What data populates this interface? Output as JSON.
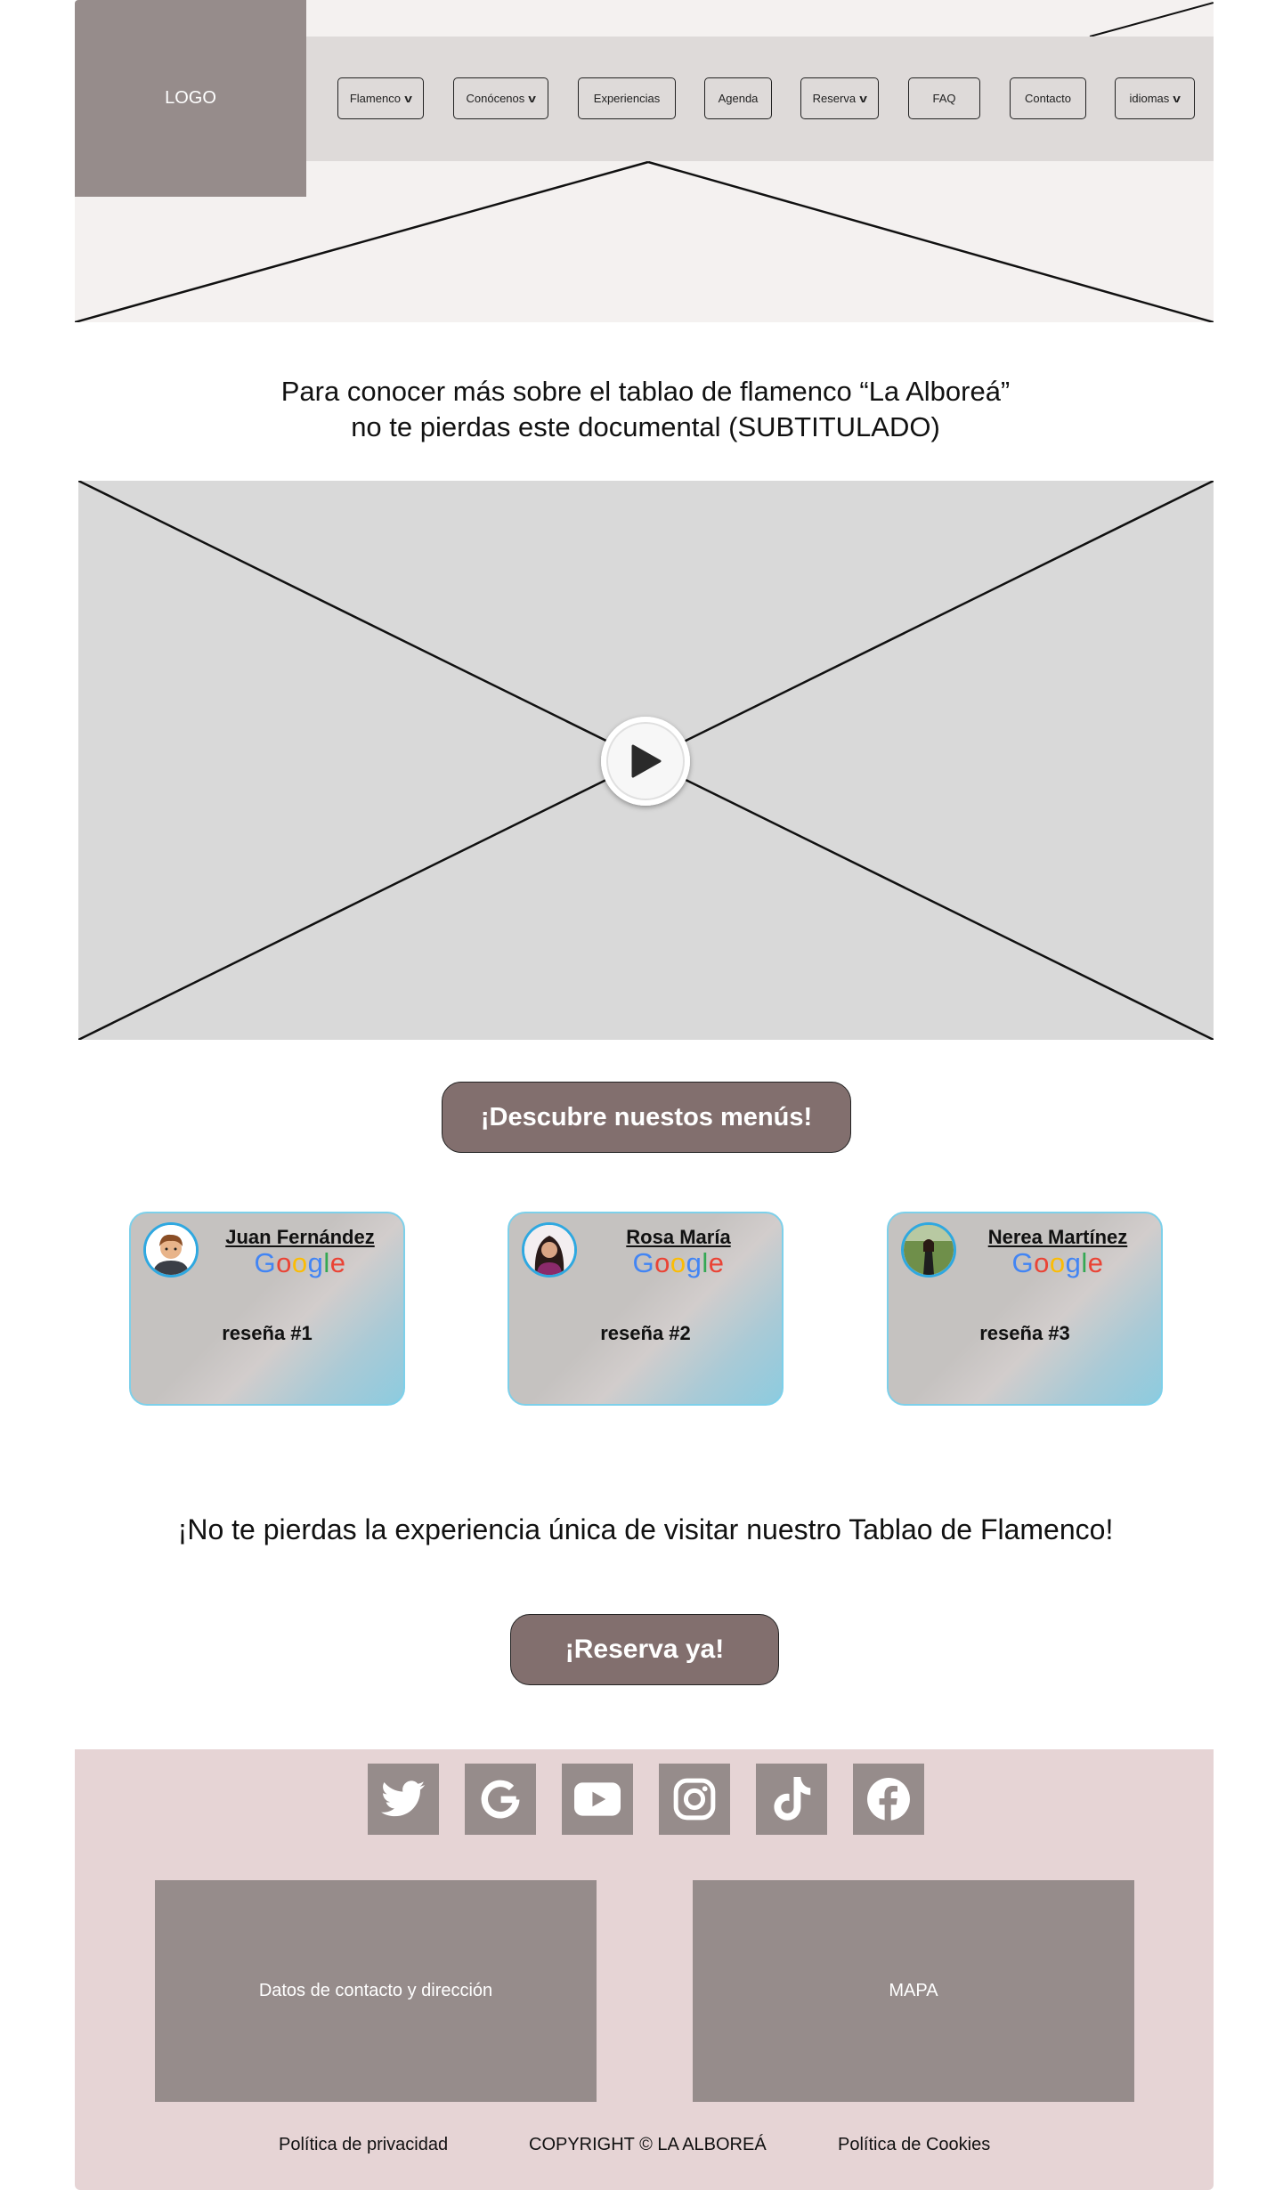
{
  "header": {
    "logo_text": "LOGO",
    "nav": [
      {
        "label": "Flamenco",
        "has_dropdown": true
      },
      {
        "label": "Conócenos",
        "has_dropdown": true
      },
      {
        "label": "Experiencias",
        "has_dropdown": false
      },
      {
        "label": "Agenda",
        "has_dropdown": false
      },
      {
        "label": "Reserva",
        "has_dropdown": true
      },
      {
        "label": "FAQ",
        "has_dropdown": false
      },
      {
        "label": "Contacto",
        "has_dropdown": false
      },
      {
        "label": "idiomas",
        "has_dropdown": true
      }
    ],
    "dropdown_glyph": "v"
  },
  "intro": {
    "line1": "Para conocer más sobre el tablao de flamenco “La Alboreá”",
    "line2": "no te pierdas este documental (SUBTITULADO)"
  },
  "video": {
    "icon": "play-icon"
  },
  "menus_button": "¡Descubre nuestos menús!",
  "reviews": [
    {
      "name": "Juan Fernández",
      "source": "Google",
      "text": "reseña #1"
    },
    {
      "name": "Rosa María",
      "source": "Google",
      "text": "reseña #2"
    },
    {
      "name": "Nerea Martínez",
      "source": "Google",
      "text": "reseña #3"
    }
  ],
  "experience_text": "¡No te pierdas la experiencia única de visitar nuestro Tablao de Flamenco!",
  "reserve_button": "¡Reserva ya!",
  "footer": {
    "social": [
      "twitter-icon",
      "google-icon",
      "youtube-icon",
      "instagram-icon",
      "tiktok-icon",
      "facebook-icon"
    ],
    "contact_box": "Datos de contacto y dirección",
    "map_box": "MAPA",
    "links": {
      "privacy": "Política de privacidad",
      "copyright": "COPYRIGHT © LA ALBOREÁ",
      "cookies": "Política de Cookies"
    }
  },
  "colors": {
    "logo_bg": "#968c8b",
    "nav_bg": "#dedad9",
    "hero_bg": "#f4f1f0",
    "cta_bg": "#826f6e",
    "footer_bg": "#e6d4d5",
    "video_bg": "#d9d9d9",
    "card_border": "#7dd0ea"
  }
}
